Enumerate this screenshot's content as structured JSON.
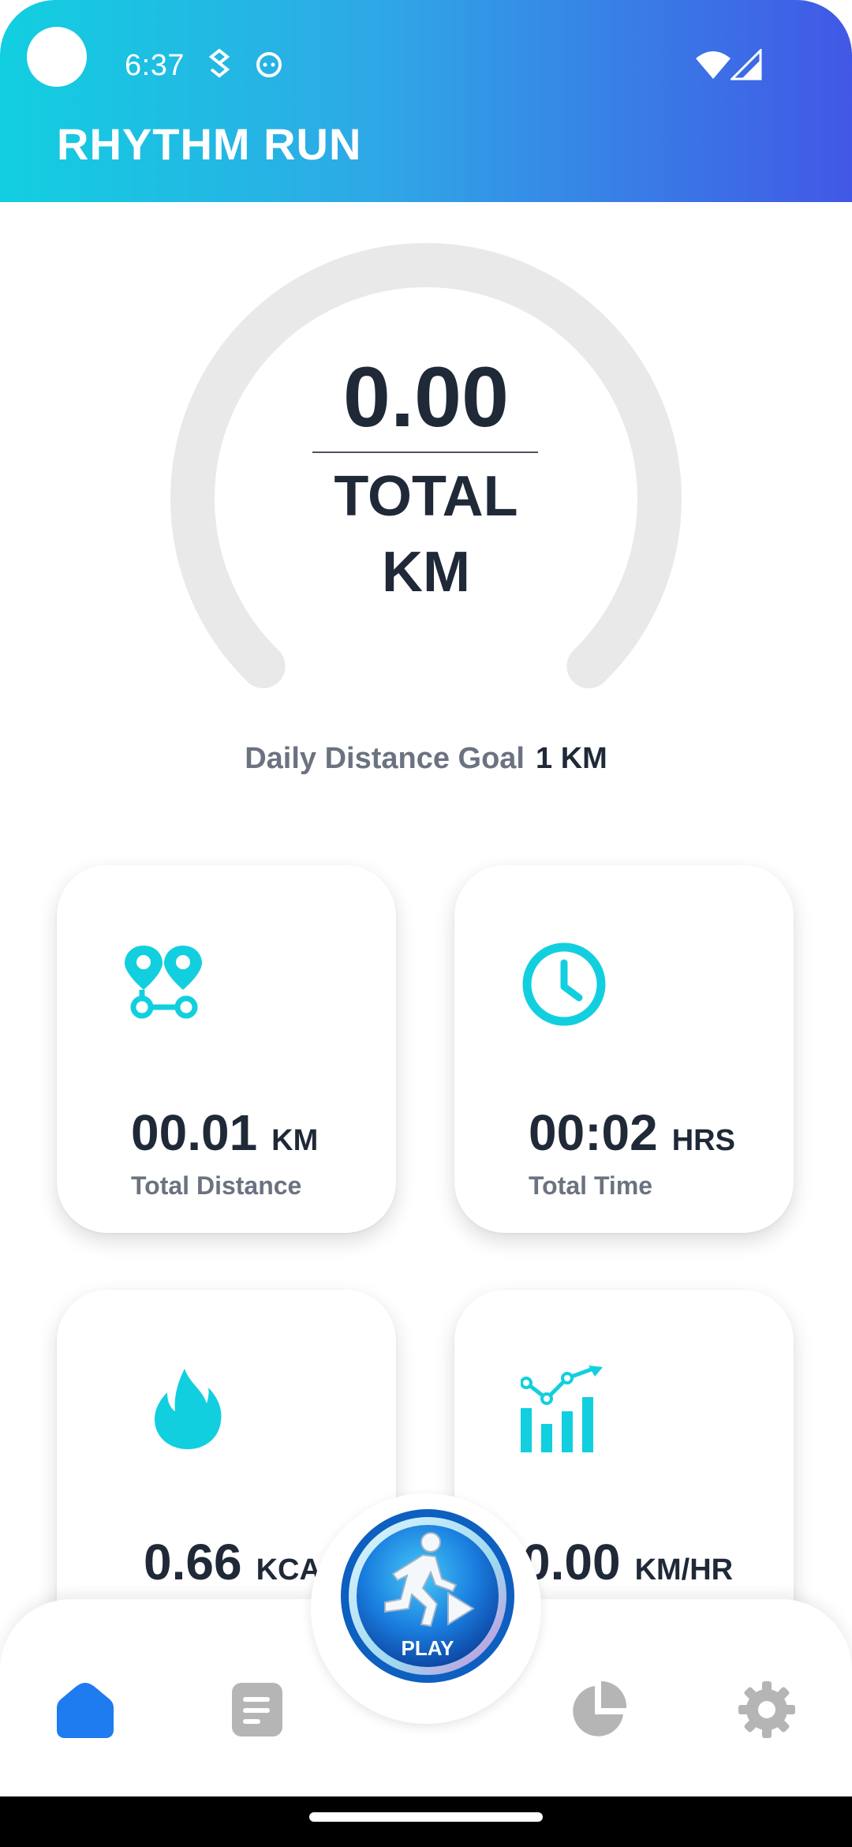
{
  "status_bar": {
    "time": "6:37"
  },
  "app": {
    "title": "RHYTHM RUN"
  },
  "gauge": {
    "value": "0.00",
    "label_line1": "TOTAL",
    "label_line2": "KM",
    "progress_fraction": 0.0
  },
  "goal": {
    "label": "Daily Distance Goal",
    "value": "1 KM"
  },
  "stats": [
    {
      "value": "00.01",
      "unit": "KM",
      "label": "Total Distance",
      "icon": "route-pins-icon"
    },
    {
      "value": "00:02",
      "unit": "HRS",
      "label": "Total Time",
      "icon": "clock-icon"
    },
    {
      "value": "0.66",
      "unit": "KCAL",
      "label": "",
      "icon": "flame-icon"
    },
    {
      "value": "0.00",
      "unit": "KM/HR",
      "label": "",
      "icon": "bar-chart-trend-icon"
    }
  ],
  "fab": {
    "label": "PLAY",
    "icon": "runner-play-icon"
  },
  "nav": [
    {
      "name": "home",
      "icon": "home-icon",
      "active": true
    },
    {
      "name": "history",
      "icon": "document-icon",
      "active": false
    },
    {
      "name": "stats",
      "icon": "pie-chart-icon",
      "active": false
    },
    {
      "name": "settings",
      "icon": "gear-icon",
      "active": false
    }
  ],
  "colors": {
    "accent": "#12CFDF",
    "active_nav": "#1E7BF0",
    "inactive_nav": "#B5B5B5",
    "gauge_track": "#E9E9E9",
    "header_start": "#12CFE0",
    "header_end": "#4158E6"
  }
}
